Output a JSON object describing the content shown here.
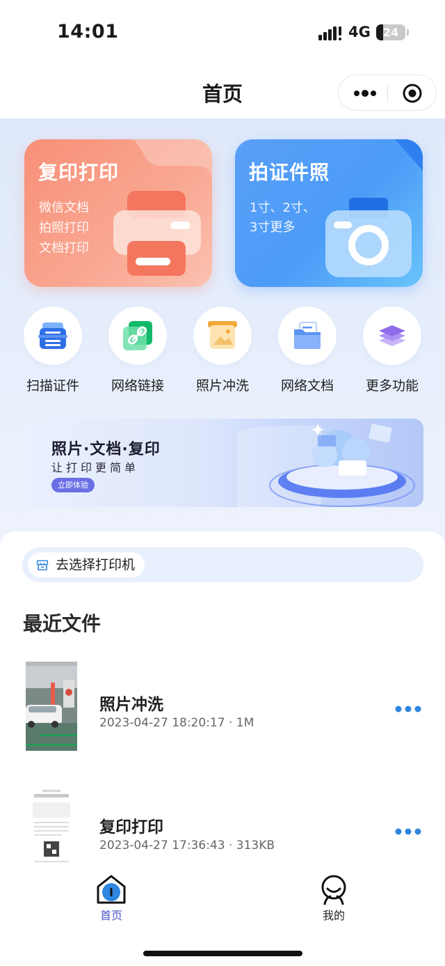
{
  "status_bar": {
    "time": "14:01",
    "network": "4G",
    "battery_text": "24",
    "battery_level": 0.24
  },
  "nav": {
    "title": "首页",
    "menu_icon": "more-dots-icon",
    "close_icon": "target-circle-icon"
  },
  "cards": [
    {
      "title": "复印打印",
      "lines": [
        "微信文档",
        "拍照打印",
        "文档打印"
      ],
      "icon": "printer-icon",
      "color": "#f88f77"
    },
    {
      "title": "拍证件照",
      "lines": [
        "1寸、2寸、",
        "3寸更多"
      ],
      "icon": "camera-icon",
      "color": "#4c9cf7"
    }
  ],
  "functions": [
    {
      "label": "扫描证件",
      "icon": "scanner-icon"
    },
    {
      "label": "网络链接",
      "icon": "link-icon"
    },
    {
      "label": "照片冲洗",
      "icon": "photo-icon"
    },
    {
      "label": "网络文档",
      "icon": "folder-icon"
    },
    {
      "label": "更多功能",
      "icon": "layers-icon"
    }
  ],
  "banner": {
    "title": "照片·文档·复印",
    "subtitle": "让打印更简单",
    "button": "立即体验"
  },
  "printer_select": {
    "label": "去选择打印机",
    "icon": "store-icon"
  },
  "recent": {
    "title": "最近文件",
    "files": [
      {
        "name": "照片冲洗",
        "meta": "2023-04-27 18:20:17 · 1M"
      },
      {
        "name": "复印打印",
        "meta": "2023-04-27 17:36:43 · 313KB"
      }
    ]
  },
  "tabs": [
    {
      "label": "首页",
      "icon": "home-icon",
      "active": true,
      "color": "#4a56c6"
    },
    {
      "label": "我的",
      "icon": "profile-icon",
      "active": false,
      "color": "#1f1f1f"
    }
  ]
}
